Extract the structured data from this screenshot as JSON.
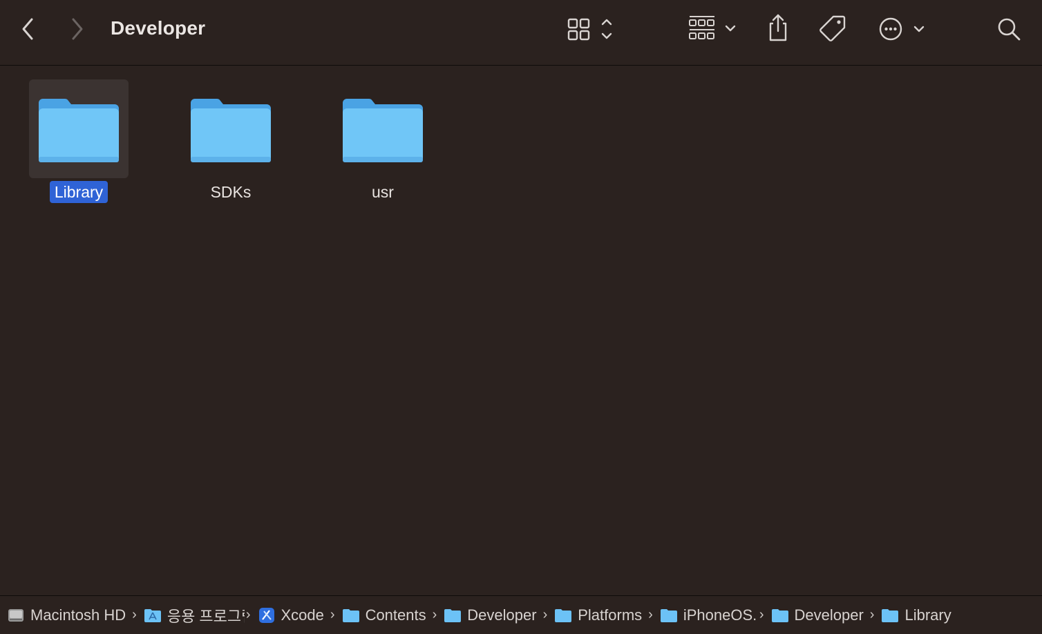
{
  "window": {
    "title": "Developer"
  },
  "toolbar": {
    "back_icon": "chevron-left-icon",
    "forward_icon": "chevron-right-icon",
    "view_icon": "grid-view-icon",
    "group_icon": "group-by-icon",
    "share_icon": "share-icon",
    "tag_icon": "tag-icon",
    "more_icon": "ellipsis-circle-icon",
    "search_icon": "search-icon"
  },
  "items": [
    {
      "label": "Library",
      "selected": true
    },
    {
      "label": "SDKs",
      "selected": false
    },
    {
      "label": "usr",
      "selected": false
    }
  ],
  "pathbar": {
    "crumbs": [
      {
        "label": "Macintosh HD",
        "icon": "hard-drive-icon"
      },
      {
        "label": "응용 프로그램",
        "icon": "applications-folder-icon"
      },
      {
        "label": "Xcode",
        "icon": "xcode-app-icon"
      },
      {
        "label": "Contents",
        "icon": "folder-icon"
      },
      {
        "label": "Developer",
        "icon": "folder-icon"
      },
      {
        "label": "Platforms",
        "icon": "folder-icon"
      },
      {
        "label": "iPhoneOS.platform",
        "icon": "folder-icon"
      },
      {
        "label": "Developer",
        "icon": "folder-icon"
      },
      {
        "label": "Library",
        "icon": "folder-icon"
      }
    ]
  },
  "colors": {
    "background": "#2b221f",
    "folder": "#6cc2f6",
    "selection": "#2f63d6"
  }
}
